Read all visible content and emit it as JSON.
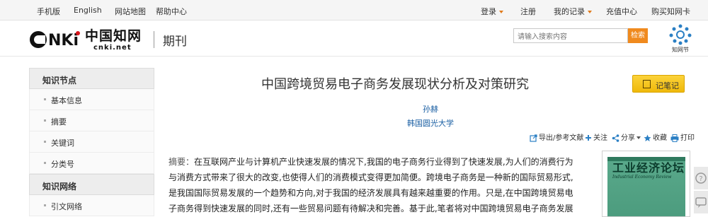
{
  "topbar": {
    "left_links": [
      "手机版",
      "English",
      "网站地图",
      "帮助中心"
    ],
    "login": "登录",
    "register": "注册",
    "my_records": "我的记录",
    "recharge": "充值中心",
    "buy_card": "购买知网卡"
  },
  "header": {
    "logo_text": "中国知网",
    "logo_sub": "cnki.net",
    "logo_mark": "CNKi",
    "section_title": "期刊",
    "search_placeholder": "请输入搜索内容",
    "search_button": "检索",
    "zw_logo_text": "知网节"
  },
  "sidebar": {
    "sections": [
      {
        "title": "知识节点",
        "items": [
          "基本信息",
          "摘要",
          "关键词",
          "分类号"
        ]
      },
      {
        "title": "知识网络",
        "items": [
          "引文网络"
        ]
      }
    ]
  },
  "article": {
    "title": "中国跨境贸易电子商务发展现状分析及对策研究",
    "author": "孙赫",
    "institution": "韩国圆光大学",
    "note_button": "记笔记",
    "toolbar": {
      "export": "导出/参考文献",
      "follow": "关注",
      "share": "分享",
      "favorite": "收藏",
      "print": "打印"
    },
    "abstract_label": "摘要：",
    "abstract_lines": [
      "在互联网产业与计算机产业快速发展的情况下,我国的电子商务行业得到了快速发展,为人们的消费行为",
      "与消费方式带来了很大的改变,也使得人们的消费模式变得更加简便。跨境电子商务是一种新的国际贸易形式,",
      "是我国国际贸易发展的一个趋势和方向,对于我国的经济发展具有越来越重要的作用。只是,在中国跨境贸易电",
      "子商务得到快速发展的同时,还有一些贸易问题有待解决和完善。基于此,笔者将对中国跨境贸易电子商务发展"
    ]
  },
  "journal_cover": {
    "title": "工业经济论坛",
    "subtitle": "Industrial Economy Review"
  },
  "colors": {
    "accent_orange": "#f08a1e",
    "link_blue": "#1a5fa3",
    "note_yellow": "#f5c520",
    "cover_green": "#4b9b7d"
  }
}
